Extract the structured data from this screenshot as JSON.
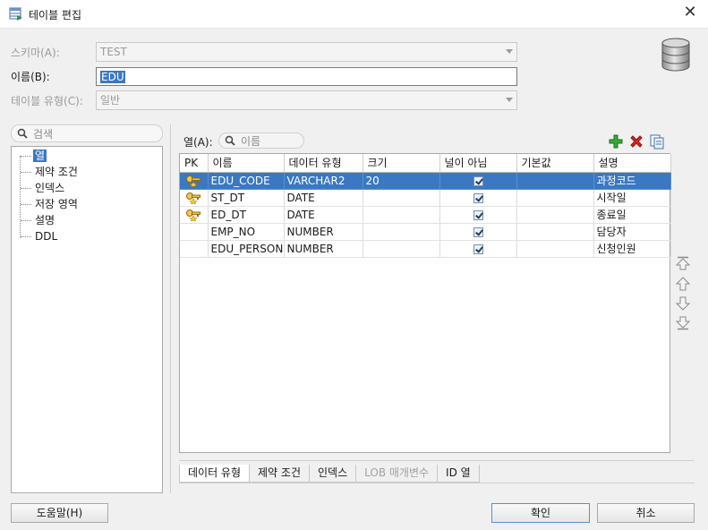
{
  "window": {
    "title": "테이블 편집"
  },
  "form": {
    "schema_label": "스키마(A):",
    "schema_value": "TEST",
    "name_label": "이름(B):",
    "name_value": "EDU",
    "type_label": "테이블 유형(C):",
    "type_value": "일반"
  },
  "sidebar": {
    "search_placeholder": "검색",
    "items": [
      {
        "label": "열",
        "selected": true
      },
      {
        "label": "제약 조건"
      },
      {
        "label": "인덱스"
      },
      {
        "label": "저장 영역"
      },
      {
        "label": "설명"
      },
      {
        "label": "DDL"
      }
    ]
  },
  "columns_panel": {
    "label": "열(A):",
    "search_placeholder": "이름",
    "add_icon": "plus-icon",
    "delete_icon": "red-x-icon",
    "copy_icon": "copy-icon"
  },
  "grid": {
    "headers": [
      "PK",
      "이름",
      "데이터 유형",
      "크기",
      "널이 아님",
      "기본값",
      "설명"
    ],
    "rows": [
      {
        "pk": true,
        "name": "EDU_CODE",
        "type": "VARCHAR2",
        "size": "20",
        "not_null": true,
        "default": "",
        "comment": "과정코드",
        "selected": true
      },
      {
        "pk": true,
        "name": "ST_DT",
        "type": "DATE",
        "size": "",
        "not_null": true,
        "default": "",
        "comment": "시작일"
      },
      {
        "pk": true,
        "name": "ED_DT",
        "type": "DATE",
        "size": "",
        "not_null": true,
        "default": "",
        "comment": "종료일"
      },
      {
        "pk": false,
        "name": "EMP_NO",
        "type": "NUMBER",
        "size": "",
        "not_null": true,
        "default": "",
        "comment": "담당자"
      },
      {
        "pk": false,
        "name": "EDU_PERSON",
        "type": "NUMBER",
        "size": "",
        "not_null": true,
        "default": "",
        "comment": "신청인원"
      }
    ]
  },
  "tabs": [
    {
      "label": "데이터 유형",
      "enabled": true
    },
    {
      "label": "제약 조건",
      "enabled": true
    },
    {
      "label": "인덱스",
      "enabled": true
    },
    {
      "label": "LOB 매개변수",
      "enabled": false
    },
    {
      "label": "ID 열",
      "enabled": true
    }
  ],
  "buttons": {
    "help": "도움말(H)",
    "ok": "확인",
    "cancel": "취소"
  },
  "colors": {
    "selection": "#3a78c3",
    "background": "#f0f0f0"
  }
}
